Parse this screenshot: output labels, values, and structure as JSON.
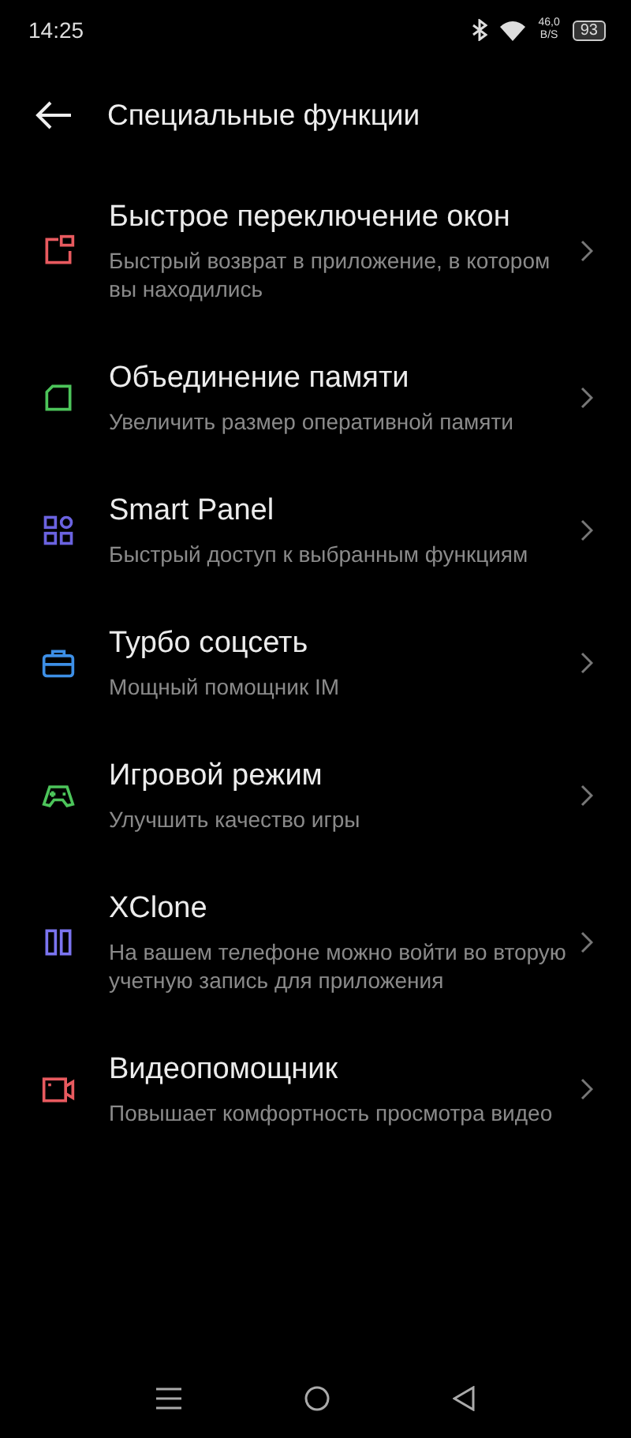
{
  "status_bar": {
    "time": "14:25",
    "speed": "46,0",
    "speed_unit": "B/S",
    "battery": "93"
  },
  "header": {
    "title": "Специальные функции"
  },
  "items": [
    {
      "kind": "windows",
      "color": "#e85a5f",
      "title": "Быстрое переключение окон",
      "subtitle": "Быстрый возврат в приложение, в котором вы находились"
    },
    {
      "kind": "memory",
      "color": "#4cc45a",
      "title": "Объединение памяти",
      "subtitle": "Увеличить размер оперативной памяти"
    },
    {
      "kind": "panel",
      "color": "#6b63e0",
      "title": "Smart Panel",
      "subtitle": "Быстрый доступ к выбранным функциям"
    },
    {
      "kind": "briefcase",
      "color": "#3d8fe6",
      "title": "Турбо соцсеть",
      "subtitle": "Мощный помощник IM"
    },
    {
      "kind": "gamepad",
      "color": "#4cc45a",
      "title": "Игровой режим",
      "subtitle": "Улучшить качество игры"
    },
    {
      "kind": "clone",
      "color": "#7b74f0",
      "title": "XClone",
      "subtitle": "На вашем телефоне можно войти во вторую учетную запись для приложения"
    },
    {
      "kind": "video",
      "color": "#e85a5f",
      "title": "Видеопомощник",
      "subtitle": "Повышает комфортность просмотра видео"
    }
  ]
}
